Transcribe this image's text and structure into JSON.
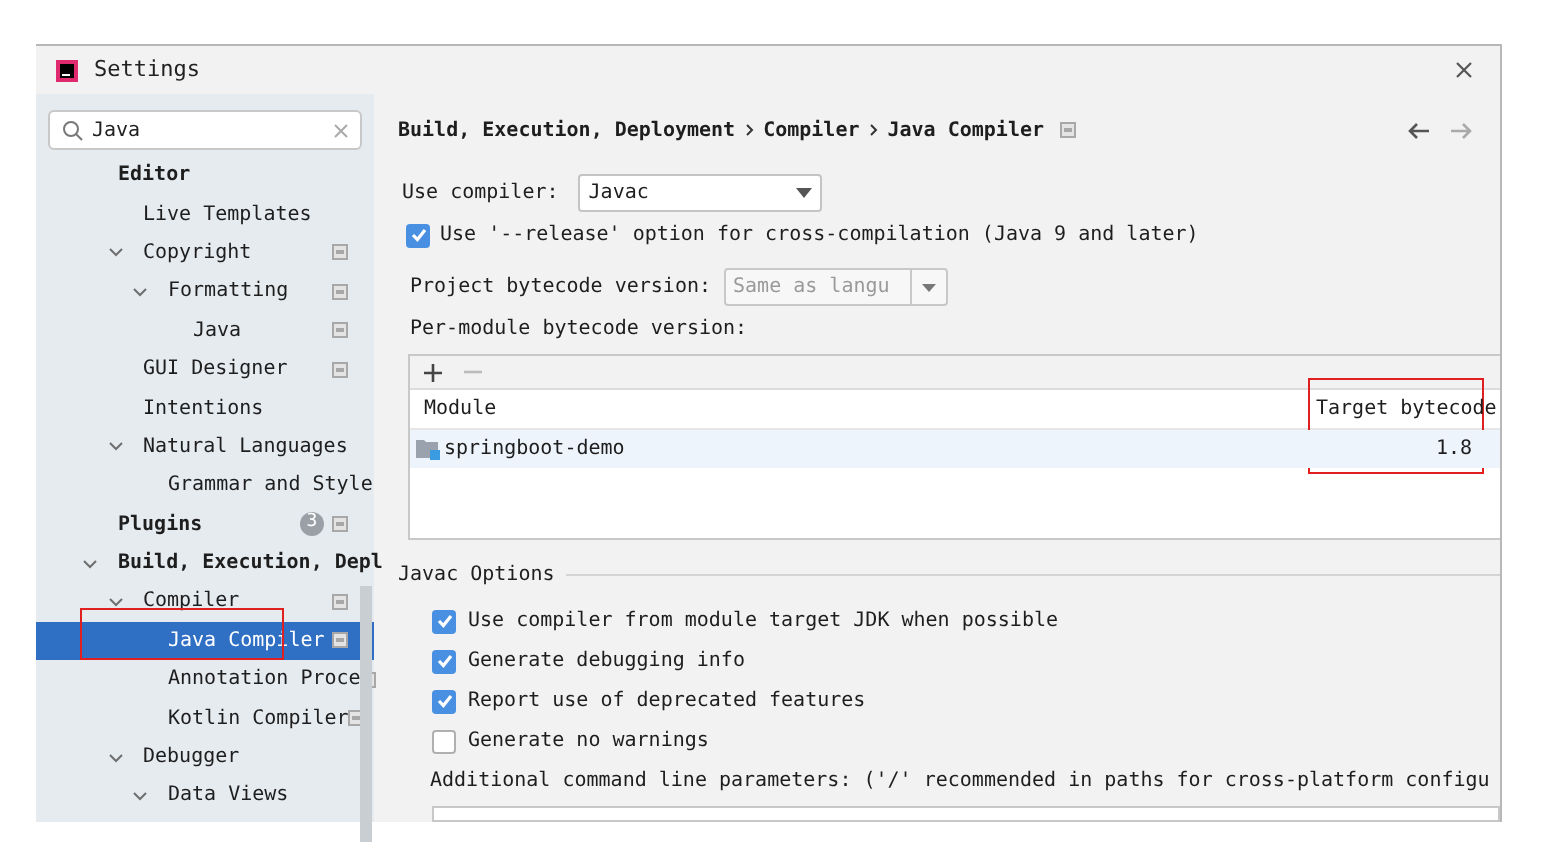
{
  "window": {
    "title": "Settings"
  },
  "search": {
    "value": "Java"
  },
  "sidebar": {
    "items": [
      {
        "label": "Editor",
        "bold": true,
        "project_scope": false,
        "selected": false,
        "children": [
          {
            "label": "Live Templates",
            "project_scope": false,
            "selected": false
          },
          {
            "label": "Copyright",
            "expanded": true,
            "project_scope": true,
            "selected": false,
            "children": [
              {
                "label": "Formatting",
                "expanded": true,
                "project_scope": true,
                "selected": false,
                "children": [
                  {
                    "label": "Java",
                    "project_scope": true,
                    "selected": false
                  }
                ]
              }
            ]
          },
          {
            "label": "GUI Designer",
            "project_scope": true,
            "selected": false
          },
          {
            "label": "Intentions",
            "project_scope": false,
            "selected": false
          },
          {
            "label": "Natural Languages",
            "expanded": true,
            "project_scope": false,
            "selected": false,
            "children": [
              {
                "label": "Grammar and Style",
                "project_scope": false,
                "selected": false
              }
            ]
          }
        ]
      },
      {
        "label": "Plugins",
        "bold": true,
        "badge": "3",
        "project_scope": true,
        "selected": false
      },
      {
        "label": "Build, Execution, Depl",
        "bold": true,
        "expanded": true,
        "project_scope": false,
        "selected": false,
        "children": [
          {
            "label": "Compiler",
            "expanded": true,
            "project_scope": true,
            "selected": false,
            "children": [
              {
                "label": "Java Compiler",
                "project_scope": true,
                "selected": true
              },
              {
                "label": "Annotation Proce",
                "project_scope": true,
                "selected": false
              },
              {
                "label": "Kotlin Compiler",
                "project_scope": true,
                "selected": false
              }
            ]
          },
          {
            "label": "Debugger",
            "expanded": true,
            "project_scope": false,
            "selected": false,
            "children": [
              {
                "label": "Data Views",
                "expanded": true,
                "project_scope": false,
                "selected": false
              }
            ]
          }
        ]
      }
    ]
  },
  "breadcrumb": [
    "Build, Execution, Deployment",
    "Compiler",
    "Java Compiler"
  ],
  "use_compiler": {
    "label": "Use compiler:",
    "value": "Javac"
  },
  "release_option": {
    "label": "Use '--release' option for cross-compilation (Java 9 and later)",
    "checked": true
  },
  "project_bytecode": {
    "label": "Project bytecode version:",
    "placeholder": "Same as langu"
  },
  "per_module": {
    "label": "Per-module bytecode version:",
    "columns": [
      "Module",
      "Target bytecode"
    ],
    "rows": [
      {
        "module": "springboot-demo",
        "target": "1.8",
        "selected": true
      }
    ]
  },
  "javac_options": {
    "title": "Javac Options",
    "options": [
      {
        "label": "Use compiler from module target JDK when possible",
        "checked": true
      },
      {
        "label": "Generate debugging info",
        "checked": true
      },
      {
        "label": "Report use of deprecated features",
        "checked": true
      },
      {
        "label": "Generate no warnings",
        "checked": false
      }
    ],
    "params_label": "Additional command line parameters:  ('/' recommended in paths for cross-platform configu"
  }
}
